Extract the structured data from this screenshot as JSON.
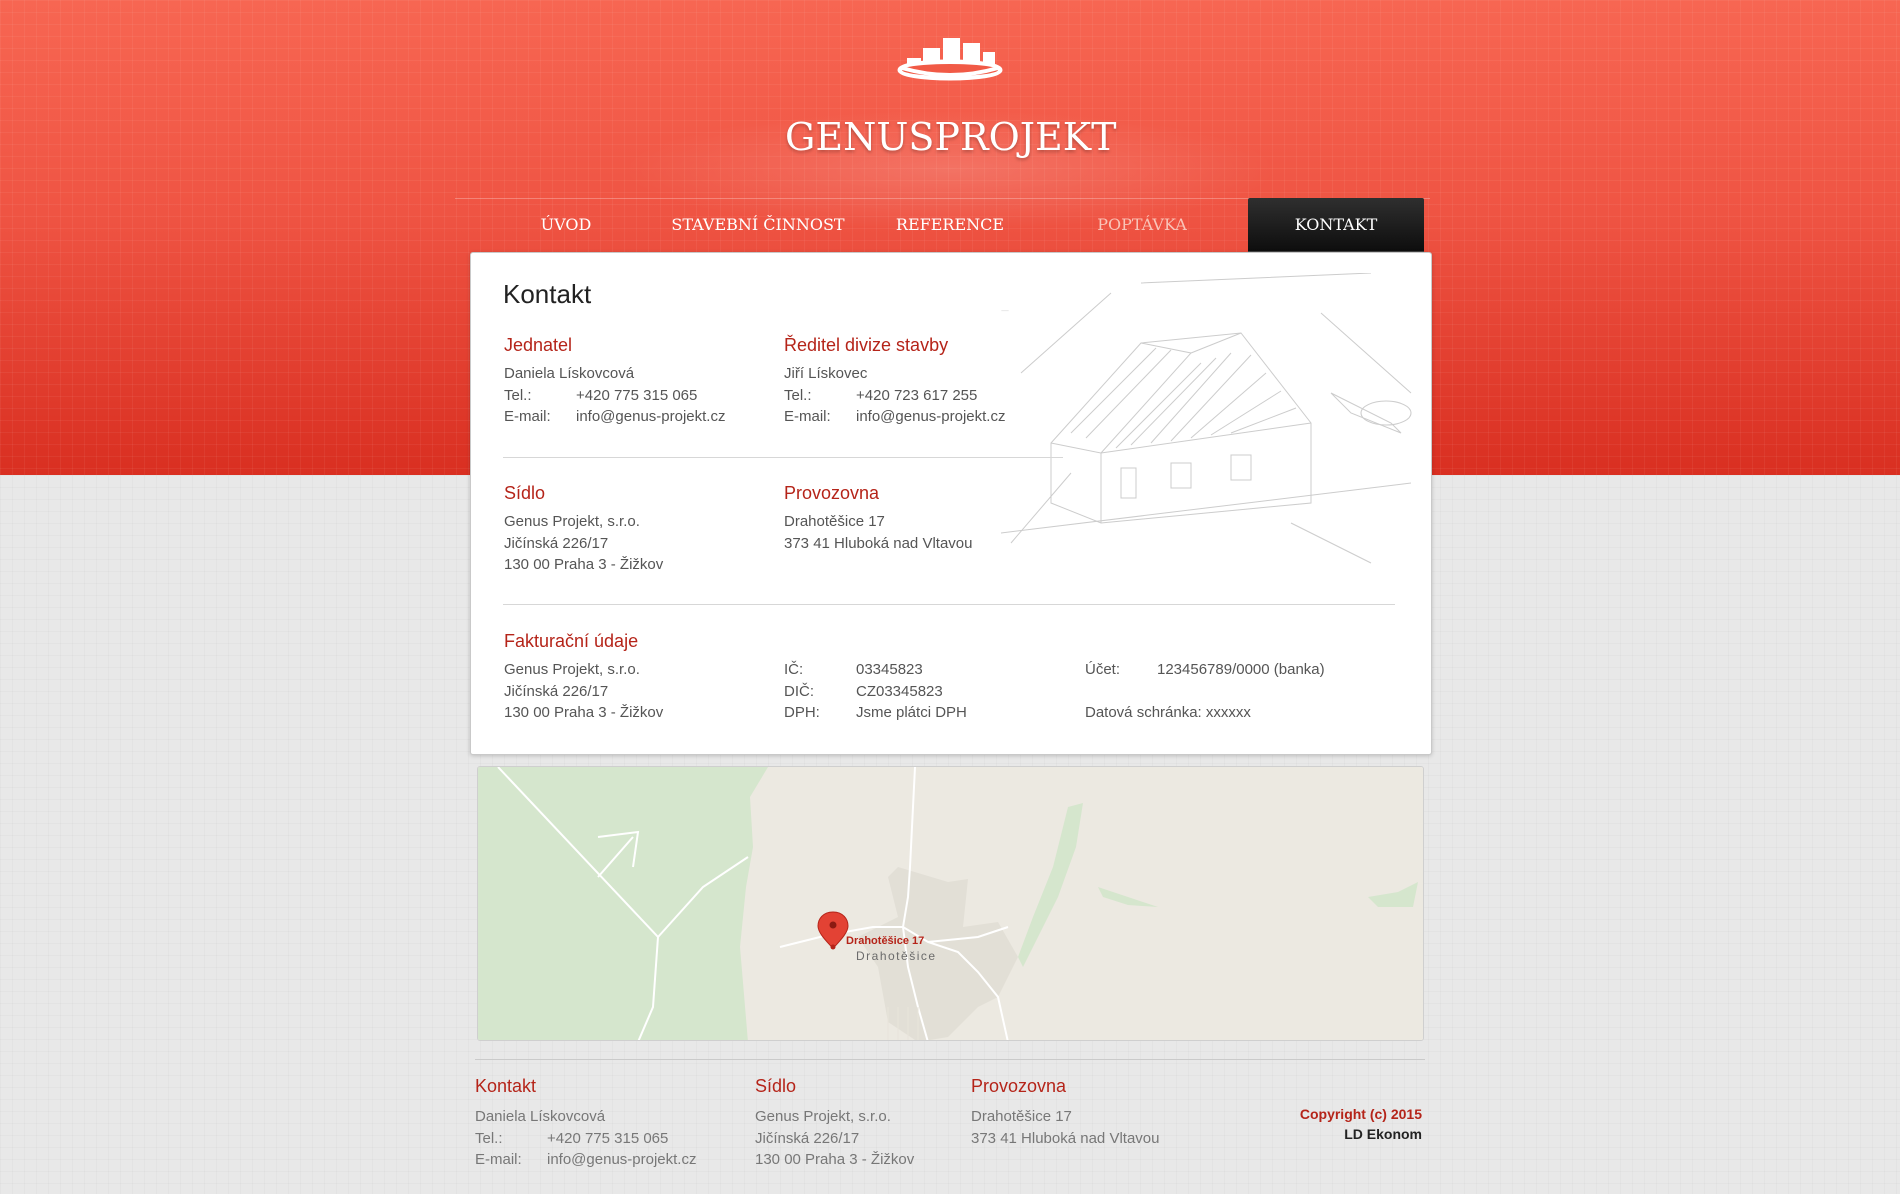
{
  "brand": {
    "name_first": "GENUS",
    "name_second": "PROJEKT"
  },
  "nav": {
    "items": [
      {
        "label": "ÚVOD"
      },
      {
        "label": "STAVEBNÍ ČINNOST"
      },
      {
        "label": "REFERENCE"
      },
      {
        "label": "POPTÁVKA"
      },
      {
        "label": "KONTAKT"
      }
    ],
    "active": "KONTAKT"
  },
  "main": {
    "title": "Kontakt",
    "jednatel": {
      "heading": "Jednatel",
      "name": "Daniela Lískovcová",
      "tel_label": "Tel.:",
      "tel": "+420 775 315 065",
      "email_label": "E-mail:",
      "email": "info@genus-projekt.cz"
    },
    "reditel": {
      "heading": "Ředitel divize stavby",
      "name": "Jiří Lískovec",
      "tel_label": "Tel.:",
      "tel": "+420 723 617 255",
      "email_label": "E-mail:",
      "email": "info@genus-projekt.cz"
    },
    "sidlo": {
      "heading": "Sídlo",
      "lines": [
        "Genus Projekt, s.r.o.",
        "Jičínská 226/17",
        "130 00  Praha 3 - Žižkov"
      ]
    },
    "provozovna": {
      "heading": "Provozovna",
      "lines": [
        "Drahotěšice 17",
        "373 41  Hluboká nad Vltavou"
      ]
    },
    "fakturace": {
      "heading": "Fakturační údaje",
      "lines": [
        "Genus Projekt, s.r.o.",
        "Jičínská 226/17",
        "130 00  Praha 3 - Žižkov"
      ],
      "ic_label": "IČ:",
      "ic": "03345823",
      "dic_label": "DIČ:",
      "dic": "CZ03345823",
      "dph_label": "DPH:",
      "dph": "Jsme plátci DPH",
      "ucet_label": "Účet:",
      "ucet": "123456789/0000 (banka)",
      "datova": "Datová schránka: xxxxxx"
    }
  },
  "map": {
    "marker_label": "Drahotěšice 17",
    "place_label": "Drahotěšice"
  },
  "footer": {
    "kontakt": {
      "heading": "Kontakt",
      "name": "Daniela Lískovcová",
      "tel_label": "Tel.:",
      "tel": "+420 775 315 065",
      "email_label": "E-mail:",
      "email": "info@genus-projekt.cz"
    },
    "sidlo": {
      "heading": "Sídlo",
      "lines": [
        "Genus Projekt, s.r.o.",
        "Jičínská 226/17",
        "130 00  Praha 3 - Žižkov"
      ]
    },
    "provozovna": {
      "heading": "Provozovna",
      "lines": [
        "Drahotěšice 17",
        "373 41  Hluboká nad Vltavou"
      ]
    },
    "copyright": "Copyright (c) 2015",
    "author": "LD Ekonom"
  },
  "colors": {
    "accent": "#b52419",
    "header_red": "#ef5443",
    "nav_active": "#111111"
  }
}
